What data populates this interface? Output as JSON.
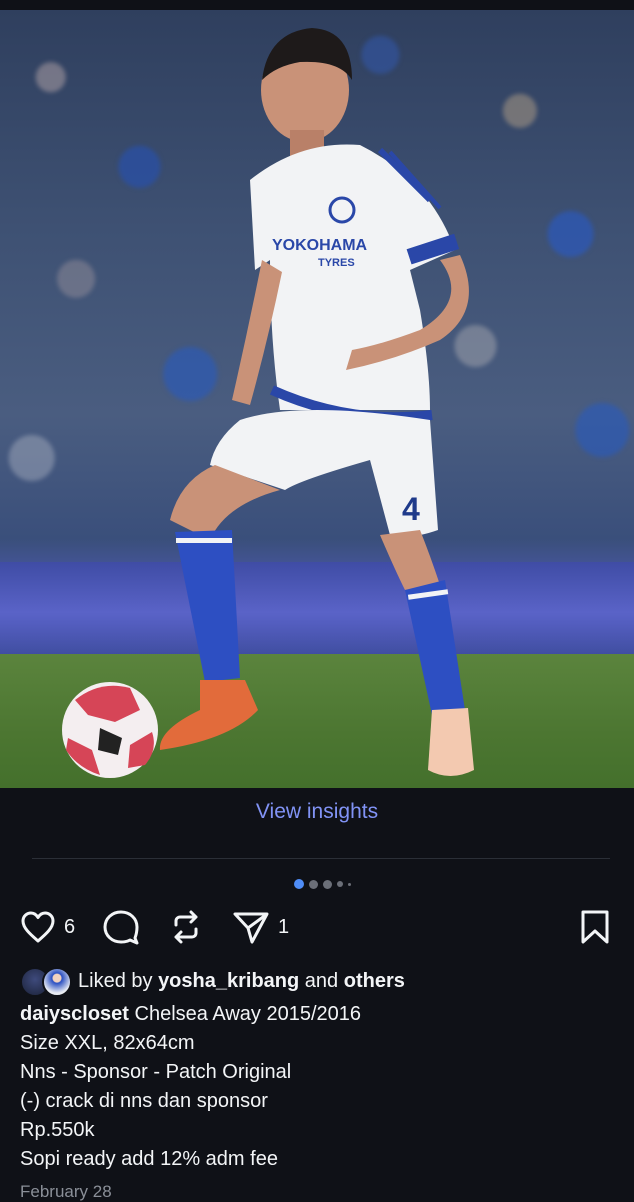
{
  "post": {
    "photo_alt": "photo-of-footballer",
    "view_insights": "View insights",
    "carousel_count": 5,
    "carousel_active": 1
  },
  "actions": {
    "likes": "6",
    "shares": "1"
  },
  "liked_by": {
    "prefix": "Liked by",
    "user": "yosha_kribang",
    "and": "and",
    "others": "others"
  },
  "caption": {
    "username": "daiyscloset",
    "title": "Chelsea Away 2015/2016",
    "lines": [
      "Size XXL, 82x64cm",
      "Nns - Sponsor - Patch Original",
      "(-) crack di nns dan sponsor",
      "Rp.550k",
      "Sopi ready add 12% adm fee"
    ]
  },
  "date": "February 28",
  "colors": {
    "background": "#0f1117",
    "link": "#8193f5",
    "active_dot": "#4f8df7"
  }
}
